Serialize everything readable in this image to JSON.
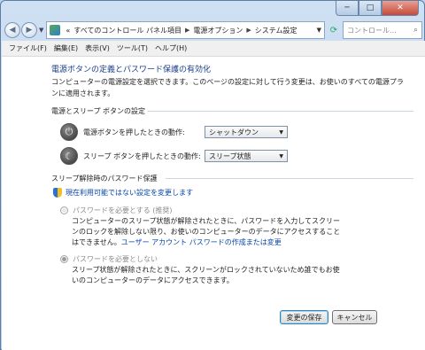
{
  "titlebar": {
    "minimize": "─",
    "maximize": "□",
    "close": "✕"
  },
  "nav": {
    "back_icon": "back-arrow-icon",
    "forward_icon": "forward-arrow-icon",
    "breadcrumbs": [
      "すべてのコントロール パネル項目",
      "電源オプション",
      "システム設定"
    ],
    "overflow": "«",
    "search_placeholder": "コントロール..."
  },
  "menu": [
    "ファイル(F)",
    "編集(E)",
    "表示(V)",
    "ツール(T)",
    "ヘルプ(H)"
  ],
  "main": {
    "title": "電源ボタンの定義とパスワード保護の有効化",
    "description": "コンピューターの電源設定を選択できます。このページの設定に対して行う変更は、お使いのすべての電源プランに適用されます。",
    "power_section_title": "電源とスリープ ボタンの設定",
    "power_button_label": "電源ボタンを押したときの動作:",
    "power_button_value": "シャットダウン",
    "sleep_button_label": "スリープ ボタンを押したときの動作:",
    "sleep_button_value": "スリープ状態",
    "password_section_title": "スリープ解除時のパスワード保護",
    "change_link": "現在利用可能ではない設定を変更します",
    "option1_label": "パスワードを必要とする (推奨)",
    "option1_desc": "コンピューターのスリープ状態が解除されたときに、パスワードを入力してスクリーンのロックを解除しない限り、お使いのコンピューターのデータにアクセスすることはできません。",
    "option1_link": "ユーザー アカウント パスワードの作成または変更",
    "option2_label": "パスワードを必要としない",
    "option2_desc": "スリープ状態が解除されたときに、スクリーンがロックされていないため誰でもお使いのコンピューターのデータにアクセスできます。",
    "save_button": "変更の保存",
    "cancel_button": "キャンセル"
  }
}
